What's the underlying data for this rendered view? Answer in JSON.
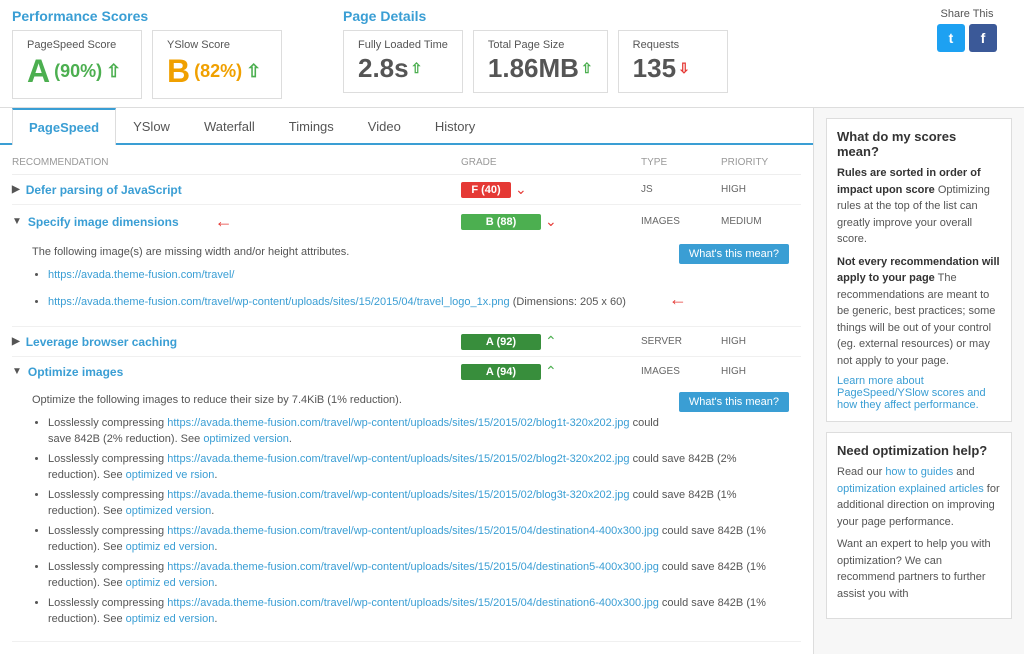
{
  "header": {
    "perf_scores_title": "Performance Scores",
    "pagespeed_label": "PageSpeed Score",
    "pagespeed_value": "A (90%)",
    "pagespeed_letter": "A",
    "pagespeed_pct": "(90%)",
    "yslow_label": "YSlow Score",
    "yslow_value": "B (82%)",
    "yslow_letter": "B",
    "yslow_pct": "(82%)",
    "page_details_title": "Page Details",
    "loaded_label": "Fully Loaded Time",
    "loaded_value": "2.8s",
    "size_label": "Total Page Size",
    "size_value": "1.86MB",
    "requests_label": "Requests",
    "requests_value": "135",
    "share_label": "Share This"
  },
  "tabs": {
    "items": [
      "PageSpeed",
      "YSlow",
      "Waterfall",
      "Timings",
      "Video",
      "History"
    ],
    "active": "PageSpeed"
  },
  "table": {
    "headers": [
      "RECOMMENDATION",
      "GRADE",
      "TYPE",
      "PRIORITY"
    ],
    "rows": [
      {
        "title": "Defer parsing of JavaScript",
        "grade": "F (40)",
        "grade_class": "red",
        "type": "JS",
        "priority": "HIGH",
        "chevron": "down",
        "expanded": false
      },
      {
        "title": "Specify image dimensions",
        "grade": "B (88)",
        "grade_class": "green",
        "type": "IMAGES",
        "priority": "MEDIUM",
        "chevron": "down",
        "expanded": true,
        "detail": {
          "text": "The following image(s) are missing width and/or height attributes.",
          "links": [
            {
              "text": "https://avada.theme-fusion.com/travel/",
              "url": "#"
            },
            {
              "text": "https://avada.theme-fusion.com/travel/wp-content/uploads/sites/15/2015/04/travel_logo_1x.png",
              "url": "#",
              "suffix": " (Dimensions: 205 x 60)"
            }
          ]
        }
      },
      {
        "title": "Leverage browser caching",
        "grade": "A (92)",
        "grade_class": "green-dark",
        "type": "SERVER",
        "priority": "HIGH",
        "chevron": "up",
        "expanded": false
      },
      {
        "title": "Optimize images",
        "grade": "A (94)",
        "grade_class": "green-dark",
        "type": "IMAGES",
        "priority": "HIGH",
        "chevron": "up",
        "expanded": true,
        "detail": {
          "text": "Optimize the following images to reduce their size by 7.4KiB (1% reduction).",
          "bullets": [
            "Losslessly compressing https://avada.theme-fusion.com/travel/wp-content/uploads/sites/15/2015/02/blog1t-320x202.jpg could save 842B (2% reduction). See optimized version.",
            "Losslessly compressing https://avada.theme-fusion.com/travel/wp-content/uploads/sites/15/2015/02/blog2t-320x202.jpg could save 842B (2% reduction). See optimized version.",
            "Losslessly compressing https://avada.theme-fusion.com/travel/wp-content/uploads/sites/15/2015/02/blog3t-320x202.jpg could save 842B (1% reduction). See optimized version.",
            "Losslessly compressing https://avada.theme-fusion.com/travel/wp-content/uploads/sites/15/2015/04/destination4-400x300.jpg could save 842B (1% reduction). See optimized version.",
            "Losslessly compressing https://avada.theme-fusion.com/travel/wp-content/uploads/sites/15/2015/04/destination5-400x300.jpg could save 842B (1% reduction). See optimized version.",
            "Losslessly compressing https://avada.theme-fusion.com/travel/wp-content/uploads/sites/15/2015/04/destination6-400x300.jpg could save 842B (1% reduction). See optimized version."
          ]
        }
      }
    ]
  },
  "sidebar": {
    "box1_title": "What do my scores mean?",
    "box1_p1_strong": "Rules are sorted in order of impact upon score",
    "box1_p1_text": "Optimizing rules at the top of the list can greatly improve your overall score.",
    "box1_p2_strong": "Not every recommendation will apply to your page",
    "box1_p2_text": "The recommendations are meant to be generic, best practices; some things will be out of your control (eg. external resources) or may not apply to your page.",
    "box1_link": "Learn more about PageSpeed/YSlow scores and how they affect performance.",
    "box2_title": "Need optimization help?",
    "box2_p1": "Read our how to guides and optimization explained articles for additional direction on improving your page performance.",
    "box2_p2": "Want an expert to help you with optimization? We can recommend partners to further assist you with"
  },
  "buttons": {
    "whats_this": "What's this mean?"
  }
}
